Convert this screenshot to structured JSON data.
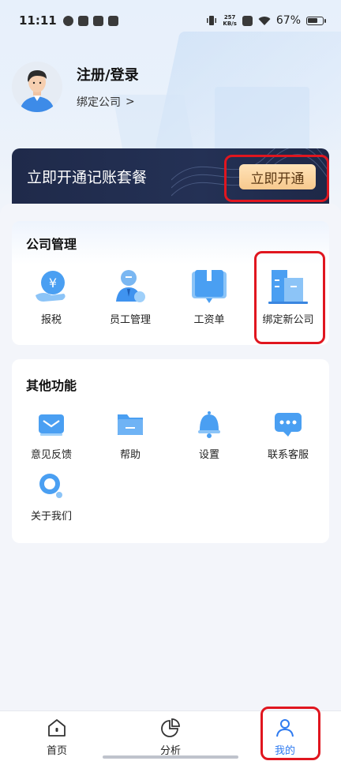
{
  "status_bar": {
    "time": "11:11",
    "net_speed_value": "257",
    "net_speed_unit": "KB/s",
    "battery": "67%"
  },
  "profile": {
    "title": "注册/登录",
    "bind_company": "绑定公司",
    "bind_arrow": ">"
  },
  "vip_banner": {
    "text": "立即开通记账套餐",
    "button": "立即开通"
  },
  "company_management": {
    "title": "公司管理",
    "items": [
      {
        "label": "报税",
        "icon": "tax-coin-icon"
      },
      {
        "label": "员工管理",
        "icon": "employee-icon"
      },
      {
        "label": "工资单",
        "icon": "payslip-book-icon"
      },
      {
        "label": "绑定新公司",
        "icon": "building-icon"
      }
    ]
  },
  "other_functions": {
    "title": "其他功能",
    "items": [
      {
        "label": "意见反馈",
        "icon": "feedback-mail-icon"
      },
      {
        "label": "帮助",
        "icon": "help-folder-icon"
      },
      {
        "label": "设置",
        "icon": "settings-bell-icon"
      },
      {
        "label": "联系客服",
        "icon": "customer-service-chat-icon"
      },
      {
        "label": "关于我们",
        "icon": "about-search-icon"
      }
    ]
  },
  "bottom_nav": {
    "items": [
      {
        "label": "首页",
        "icon": "home-icon"
      },
      {
        "label": "分析",
        "icon": "pie-chart-icon"
      },
      {
        "label": "我的",
        "icon": "user-icon",
        "active": true
      }
    ]
  },
  "colors": {
    "accent": "#2f7bf0",
    "banner_bg": "#1f2a4a",
    "button_gold": "#f7c98e",
    "annotation_red": "#e0161f"
  }
}
